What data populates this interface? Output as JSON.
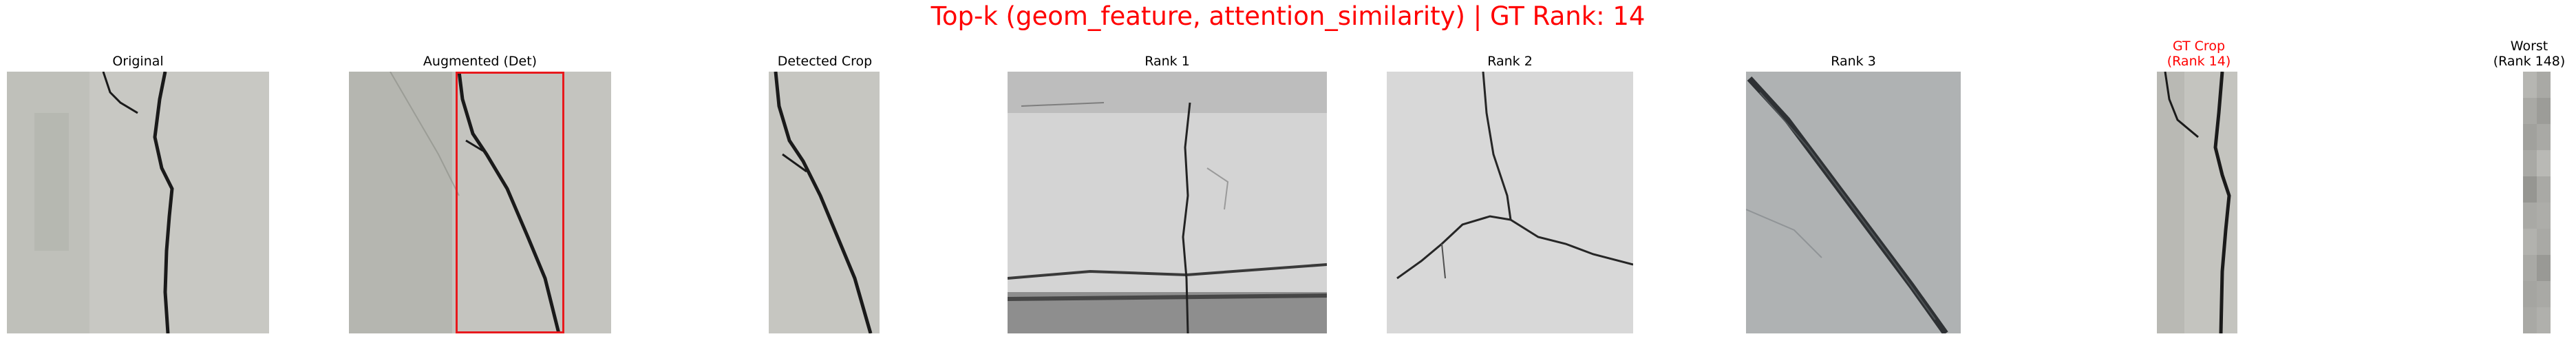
{
  "figure": {
    "title": "Top-k (geom_feature, attention_similarity) | GT Rank: 14",
    "title_color": "#ff0000"
  },
  "panels": [
    {
      "title_lines": [
        "Original"
      ],
      "title_color": "#000000"
    },
    {
      "title_lines": [
        "Augmented (Det)"
      ],
      "title_color": "#000000",
      "overlay": "red-detection-box"
    },
    {
      "title_lines": [
        "Detected Crop"
      ],
      "title_color": "#000000"
    },
    {
      "title_lines": [
        "Rank 1"
      ],
      "title_color": "#000000"
    },
    {
      "title_lines": [
        "Rank 2"
      ],
      "title_color": "#000000"
    },
    {
      "title_lines": [
        "Rank 3"
      ],
      "title_color": "#000000"
    },
    {
      "title_lines": [
        "GT Crop",
        "(Rank 14)"
      ],
      "title_color": "#ff0000"
    },
    {
      "title_lines": [
        "Worst",
        "(Rank 148)"
      ],
      "title_color": "#000000"
    }
  ],
  "colors": {
    "concrete_light": "#cfcfcb",
    "concrete_mid": "#b7b7b2",
    "crack": "#1a1a1a",
    "detection_box": "#e8191d"
  }
}
